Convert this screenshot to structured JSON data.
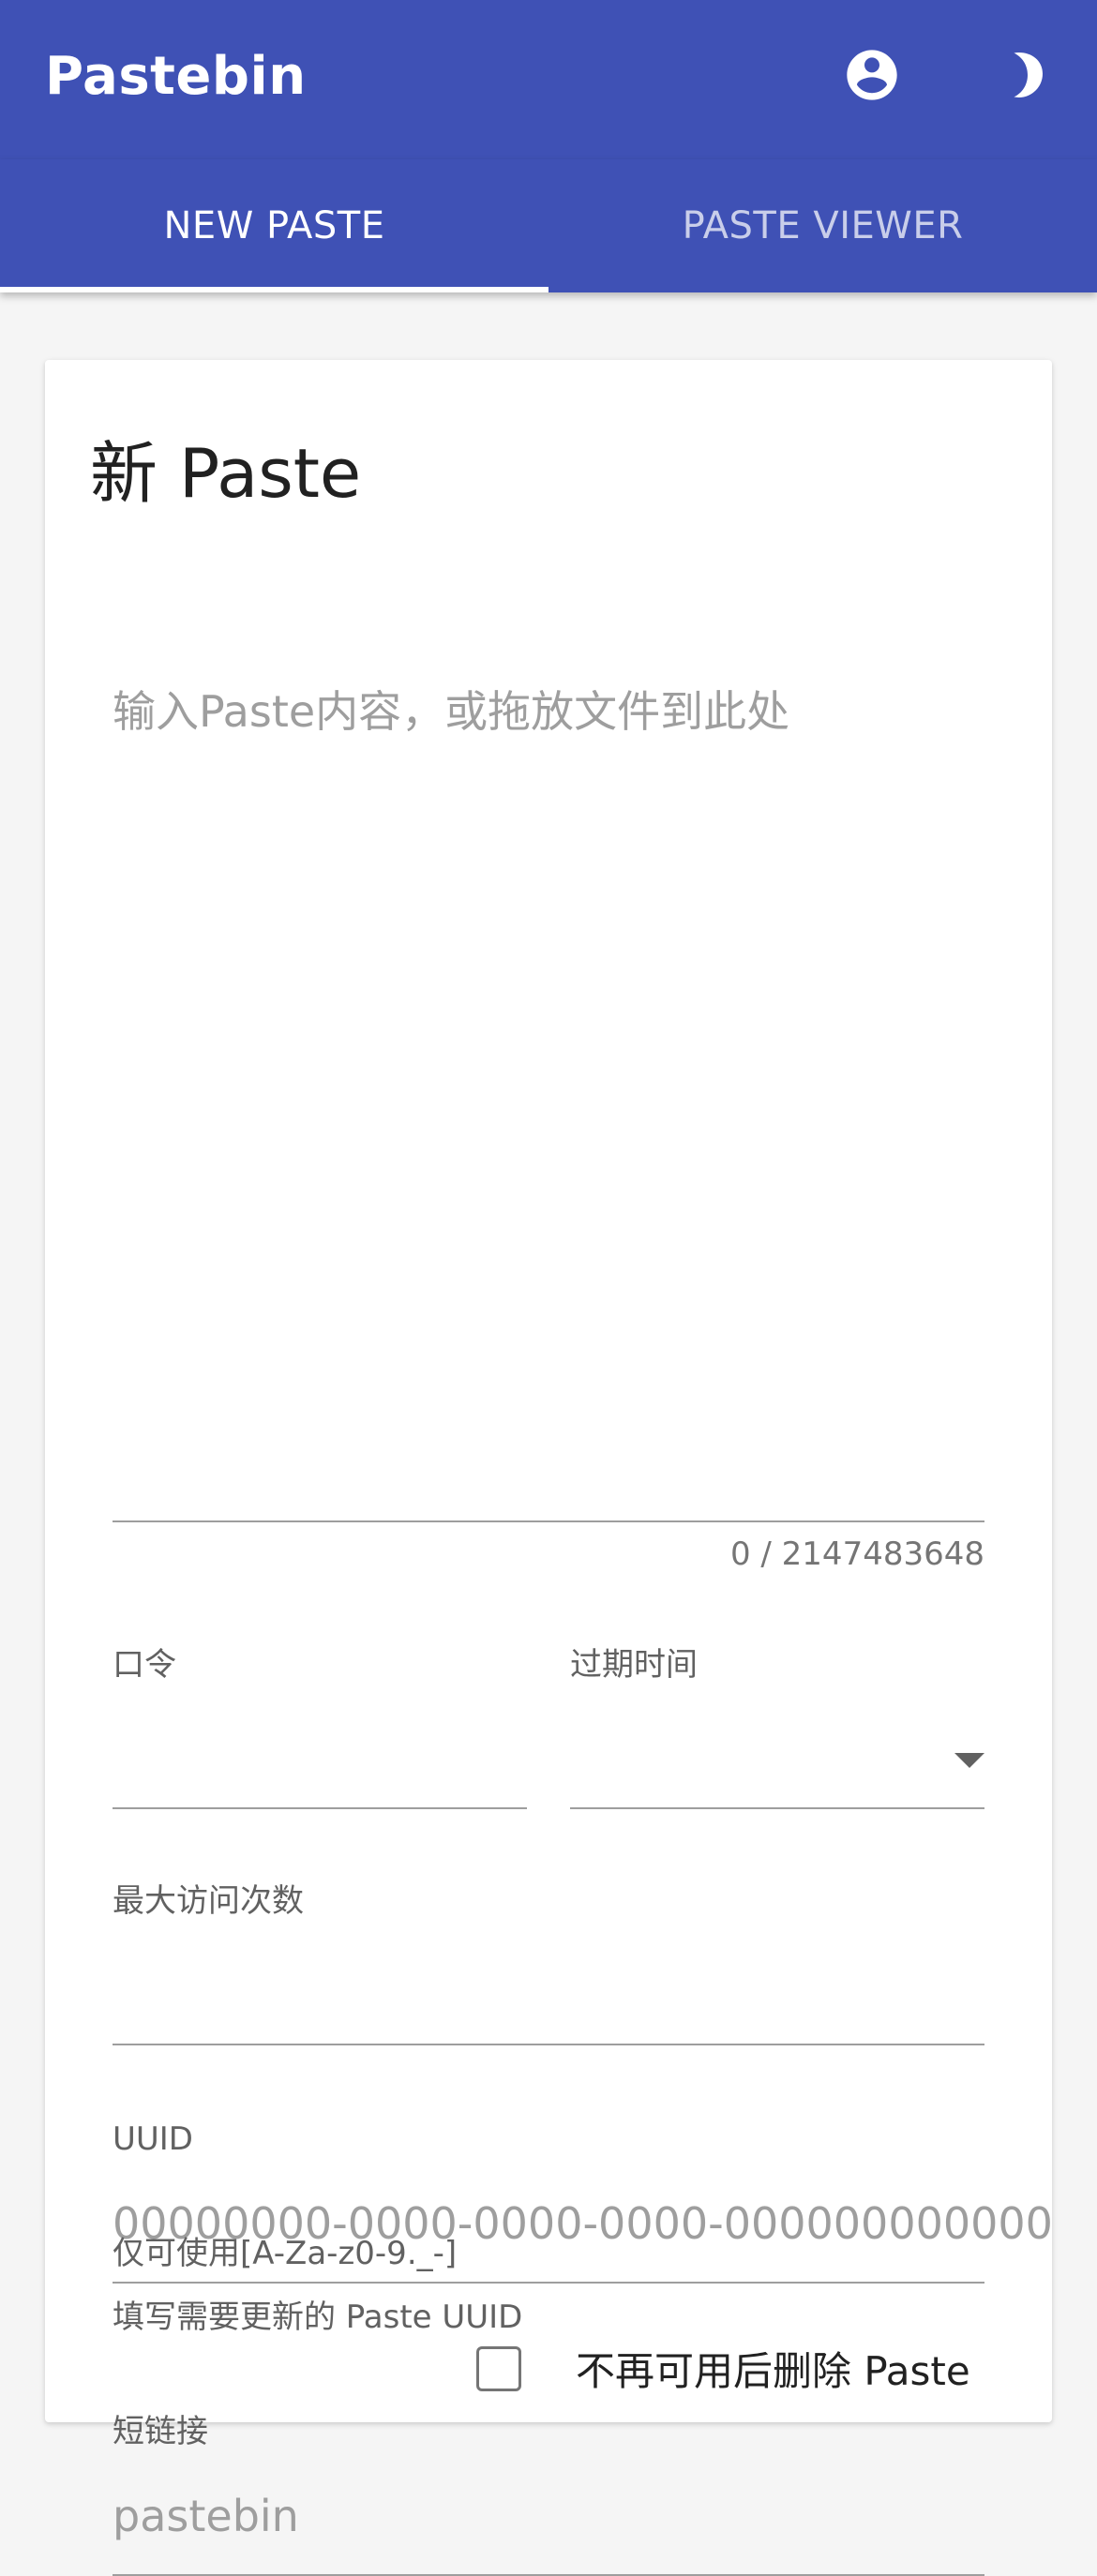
{
  "app": {
    "title": "Pastebin"
  },
  "header": {
    "account_icon": "account-circle-icon",
    "theme_icon": "crescent-moon-icon"
  },
  "tabs": [
    {
      "label": "NEW PASTE",
      "active": true
    },
    {
      "label": "PASTE VIEWER",
      "active": false
    }
  ],
  "card": {
    "title": "新 Paste",
    "content": {
      "placeholder": "输入Paste内容，或拖放文件到此处",
      "counter": "0 / 2147483648"
    },
    "password": {
      "label": "口令",
      "value": ""
    },
    "expiration": {
      "label": "过期时间",
      "value": ""
    },
    "max_visits": {
      "label": "最大访问次数",
      "value": ""
    },
    "uuid": {
      "label": "UUID",
      "placeholder": "00000000-0000-0000-0000-000000000000",
      "hint": "填写需要更新的 Paste UUID"
    },
    "short_link": {
      "label": "短链接",
      "placeholder": "pastebin",
      "hint": "仅可使用[A-Za-z0-9._-]"
    },
    "delete_checkbox": {
      "label": "不再可用后删除 Paste",
      "checked": false
    }
  },
  "colors": {
    "primary": "#3f51b5",
    "background": "#f5f5f5",
    "card": "#ffffff"
  }
}
